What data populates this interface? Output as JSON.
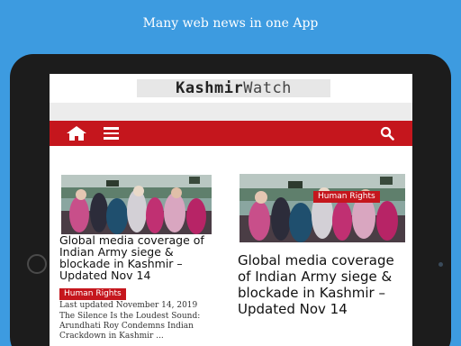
{
  "banner": {
    "text": "Many web news in one App"
  },
  "site": {
    "logo_main": "Kashmir",
    "logo_accent": "Watch"
  },
  "nav": {
    "home_icon": "home-icon",
    "menu_icon": "hamburger-menu-icon",
    "search_icon": "search-icon",
    "bar_color": "#c5161d"
  },
  "articles": [
    {
      "headline": "Global media coverage of Indian Army siege & blockade in Kashmir – Updated Nov 14",
      "category": "Human Rights",
      "updated": "Last updated November 14, 2019",
      "excerpt": "The Silence Is the Loudest Sound: Arundhati Roy Condemns Indian Crackdown in Kashmir ..."
    },
    {
      "headline": "Global media coverage of Indian Army siege & blockade in Kashmir – Updated Nov 14",
      "category": "Human Rights"
    }
  ]
}
